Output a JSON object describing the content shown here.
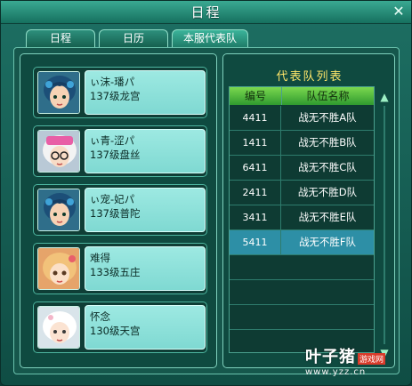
{
  "window": {
    "title": "日程",
    "close_symbol": "✕"
  },
  "tabs": [
    {
      "label": "日程",
      "active": false
    },
    {
      "label": "日历",
      "active": false
    },
    {
      "label": "本服代表队",
      "active": true
    }
  ],
  "members": [
    {
      "name": "ぃ沫-璠パ",
      "detail": "137级龙宫"
    },
    {
      "name": "ぃ青-涩パ",
      "detail": "137级盘丝"
    },
    {
      "name": "ぃ宠-妃パ",
      "detail": "137级普陀"
    },
    {
      "name": "难得",
      "detail": "133级五庄"
    },
    {
      "name": "怀念",
      "detail": "130级天宫"
    }
  ],
  "team_list": {
    "title": "代表队列表",
    "headers": [
      "编号",
      "队伍名称"
    ],
    "rows": [
      {
        "id": "4411",
        "name": "战无不胜A队",
        "selected": false
      },
      {
        "id": "1411",
        "name": "战无不胜B队",
        "selected": false
      },
      {
        "id": "6411",
        "name": "战无不胜C队",
        "selected": false
      },
      {
        "id": "2411",
        "name": "战无不胜D队",
        "selected": false
      },
      {
        "id": "3411",
        "name": "战无不胜E队",
        "selected": false
      },
      {
        "id": "5411",
        "name": "战无不胜F队",
        "selected": true
      }
    ]
  },
  "watermark": {
    "brand": "叶子猪",
    "badge": "游戏网",
    "url": "www.yzz.cn"
  },
  "colors": {
    "accent_title": "#ffe66a",
    "selected_row": "#2d8fa6",
    "header_green": "#5fc23f"
  }
}
